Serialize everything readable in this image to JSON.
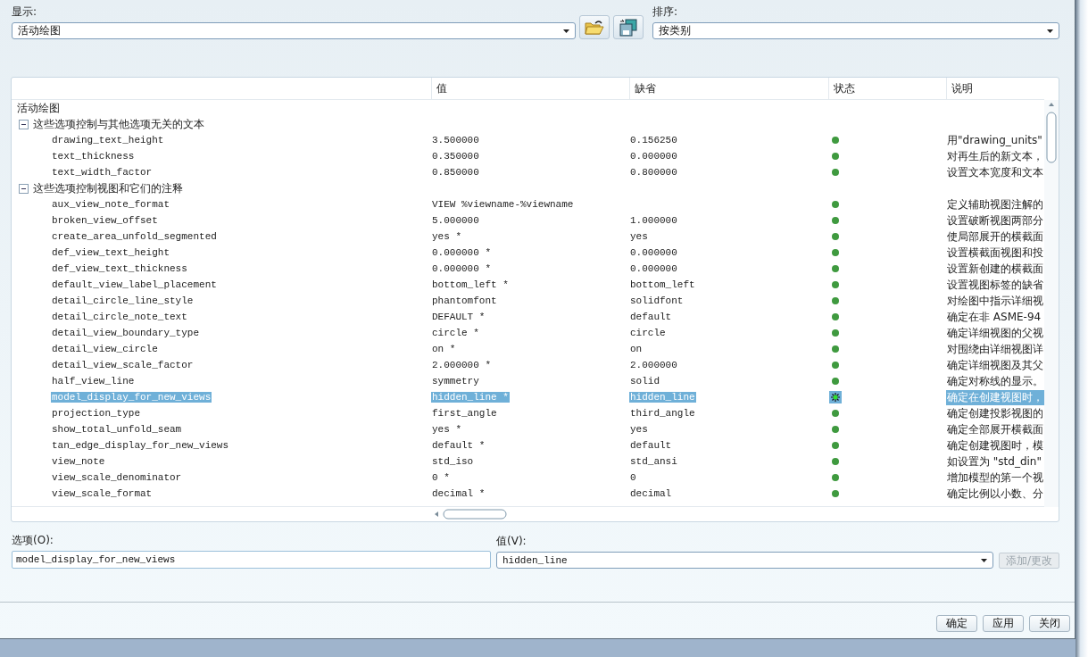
{
  "display": {
    "label": "显示:",
    "value": "活动绘图"
  },
  "sort": {
    "label": "排序:",
    "value": "按类别"
  },
  "table": {
    "columns": [
      "值",
      "缺省",
      "状态",
      "说明"
    ],
    "root": "活动绘图",
    "groups": [
      {
        "label": "这些选项控制与其他选项无关的文本",
        "expanded": true,
        "rows": [
          {
            "name": "drawing_text_height",
            "value": "3.500000",
            "default": "0.156250",
            "description": "用\"drawing_units\"",
            "selected": false
          },
          {
            "name": "text_thickness",
            "value": "0.350000",
            "default": "0.000000",
            "description": "对再生后的新文本，",
            "selected": false
          },
          {
            "name": "text_width_factor",
            "value": "0.850000",
            "default": "0.800000",
            "description": "设置文本宽度和文本",
            "selected": false
          }
        ]
      },
      {
        "label": "这些选项控制视图和它们的注释",
        "expanded": true,
        "rows": [
          {
            "name": "aux_view_note_format",
            "value": "VIEW %viewname-%viewname",
            "default": "",
            "description": "定义辅助视图注解的",
            "selected": false
          },
          {
            "name": "broken_view_offset",
            "value": "5.000000",
            "default": "1.000000",
            "description": "设置破断视图两部分",
            "selected": false
          },
          {
            "name": "create_area_unfold_segmented",
            "value": "yes *",
            "default": "yes",
            "description": "使局部展开的横截面",
            "selected": false
          },
          {
            "name": "def_view_text_height",
            "value": "0.000000 *",
            "default": "0.000000",
            "description": "设置横截面视图和投",
            "selected": false
          },
          {
            "name": "def_view_text_thickness",
            "value": "0.000000 *",
            "default": "0.000000",
            "description": "设置新创建的横截面",
            "selected": false
          },
          {
            "name": "default_view_label_placement",
            "value": "bottom_left *",
            "default": "bottom_left",
            "description": "设置视图标签的缺省",
            "selected": false
          },
          {
            "name": "detail_circle_line_style",
            "value": "phantomfont",
            "default": "solidfont",
            "description": "对绘图中指示详细视",
            "selected": false
          },
          {
            "name": "detail_circle_note_text",
            "value": "DEFAULT *",
            "default": "default",
            "description": "确定在非 ASME-94",
            "selected": false
          },
          {
            "name": "detail_view_boundary_type",
            "value": "circle *",
            "default": "circle",
            "description": "确定详细视图的父视",
            "selected": false
          },
          {
            "name": "detail_view_circle",
            "value": "on *",
            "default": "on",
            "description": "对围绕由详细视图详",
            "selected": false
          },
          {
            "name": "detail_view_scale_factor",
            "value": "2.000000 *",
            "default": "2.000000",
            "description": "确定详细视图及其父",
            "selected": false
          },
          {
            "name": "half_view_line",
            "value": "symmetry",
            "default": "solid",
            "description": "确定对称线的显示。",
            "selected": false
          },
          {
            "name": "model_display_for_new_views",
            "value": "hidden_line *",
            "default": "hidden_line",
            "description": "确定在创建视图时，",
            "selected": true
          },
          {
            "name": "projection_type",
            "value": "first_angle",
            "default": "third_angle",
            "description": "确定创建投影视图的",
            "selected": false
          },
          {
            "name": "show_total_unfold_seam",
            "value": "yes *",
            "default": "yes",
            "description": "确定全部展开横截面",
            "selected": false
          },
          {
            "name": "tan_edge_display_for_new_views",
            "value": "default *",
            "default": "default",
            "description": "确定创建视图时，模",
            "selected": false
          },
          {
            "name": "view_note",
            "value": "std_iso",
            "default": "std_ansi",
            "description": "如设置为 \"std_din\"",
            "selected": false
          },
          {
            "name": "view_scale_denominator",
            "value": "0 *",
            "default": "0",
            "description": "增加模型的第一个视",
            "selected": false
          },
          {
            "name": "view_scale_format",
            "value": "decimal *",
            "default": "decimal",
            "description": "确定比例以小数、分",
            "selected": false
          }
        ]
      }
    ]
  },
  "option_field": {
    "label": "选项(O):",
    "value": "model_display_for_new_views"
  },
  "value_field": {
    "label": "值(V):",
    "value": "hidden_line"
  },
  "add_button": {
    "label": "添加/更改",
    "disabled": true
  },
  "buttons": [
    "确定",
    "应用",
    "关闭"
  ]
}
